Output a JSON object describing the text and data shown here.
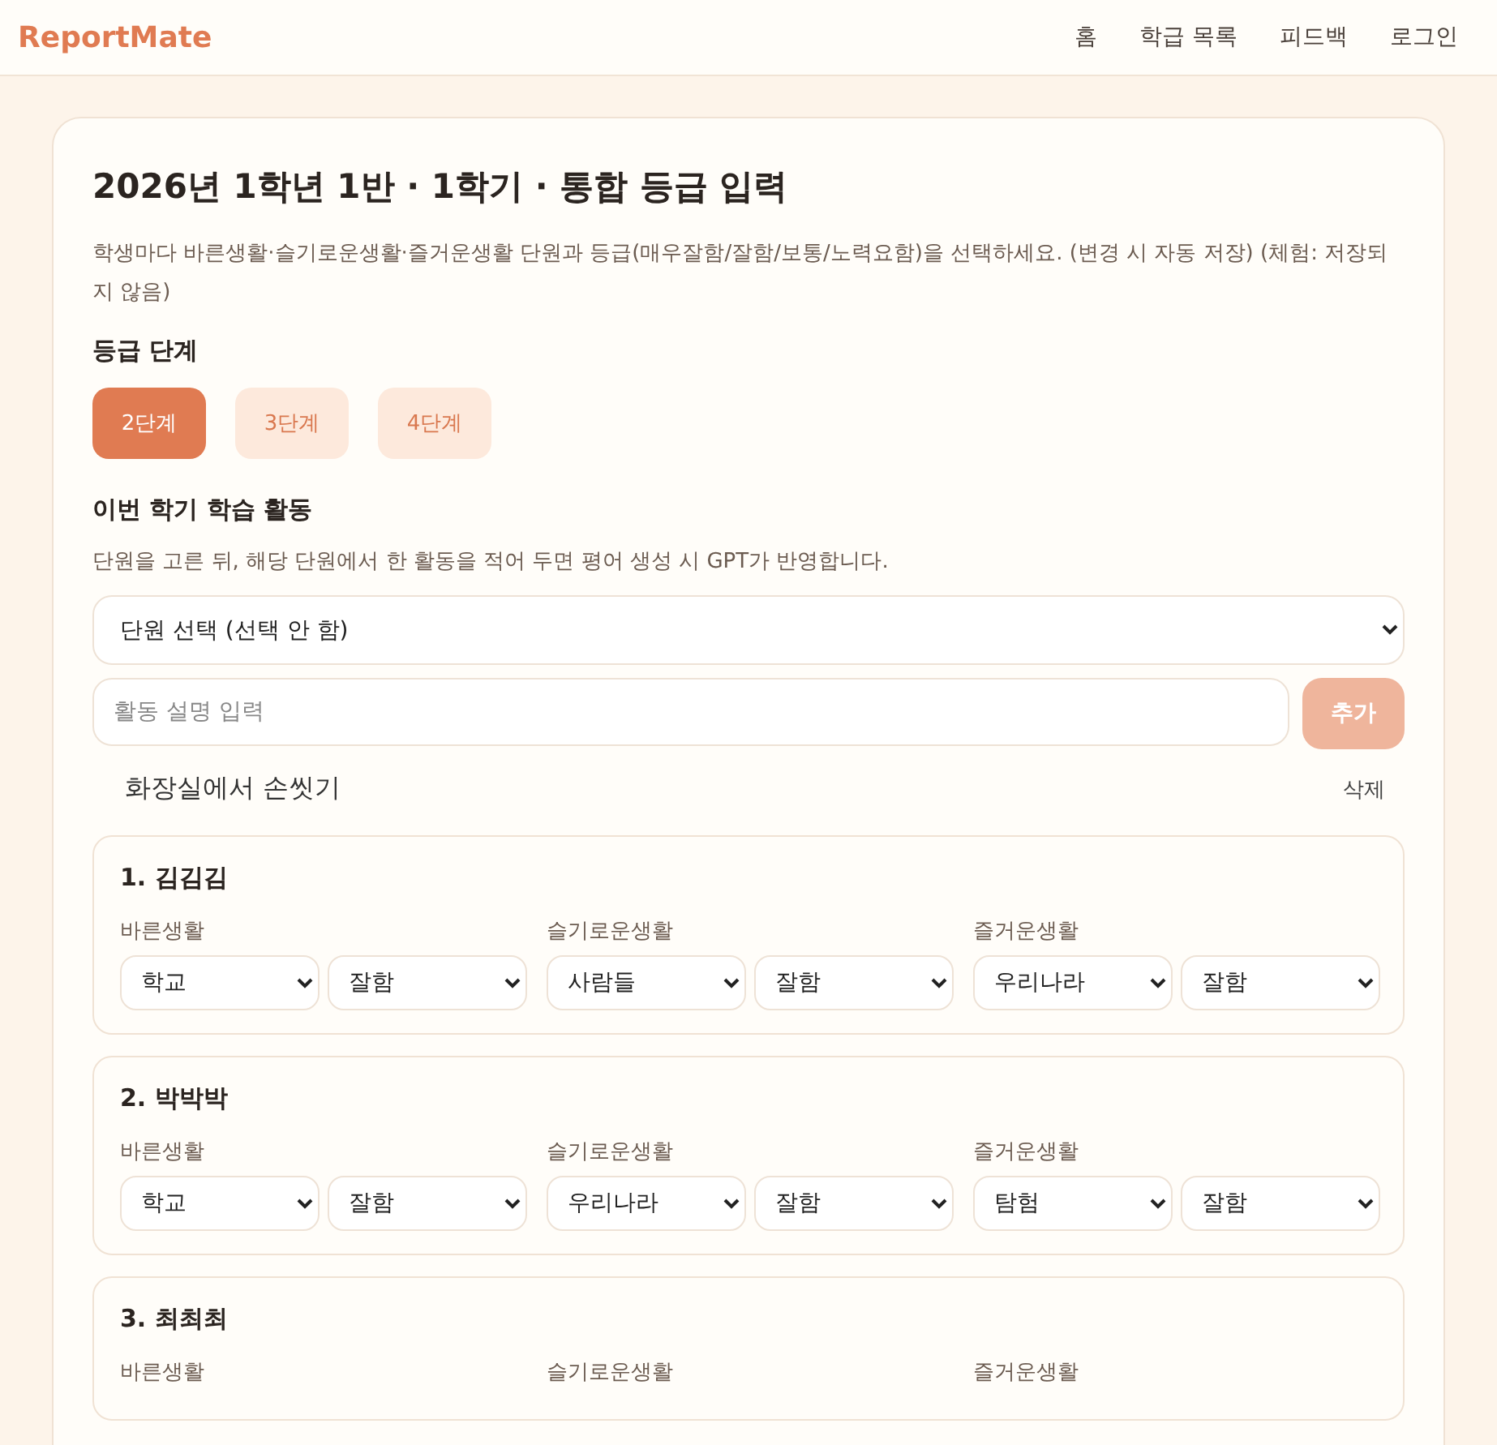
{
  "header": {
    "logo": "ReportMate",
    "nav": [
      "홈",
      "학급 목록",
      "피드백",
      "로그인"
    ]
  },
  "page": {
    "title": "2026년 1학년 1반 · 1학기 · 통합 등급 입력",
    "description": "학생마다 바른생활·슬기로운생활·즐거운생활 단원과 등급(매우잘함/잘함/보통/노력요함)을 선택하세요. (변경 시 자동 저장) (체험: 저장되지 않음)"
  },
  "grade_levels": {
    "heading": "등급 단계",
    "options": [
      {
        "label": "2단계",
        "selected": true
      },
      {
        "label": "3단계",
        "selected": false
      },
      {
        "label": "4단계",
        "selected": false
      }
    ]
  },
  "activities": {
    "heading": "이번 학기 학습 활동",
    "hint": "단원을 고른 뒤, 해당 단원에서 한 활동을 적어 두면 평어 생성 시 GPT가 반영합니다.",
    "unit_select": {
      "value": "단원 선택 (선택 안 함)"
    },
    "input": {
      "placeholder": "활동 설명 입력"
    },
    "add_button": {
      "label": "추가",
      "disabled": true
    },
    "items": [
      {
        "text": "화장실에서 손씻기",
        "delete_label": "삭제"
      }
    ]
  },
  "students": [
    {
      "name": "1. 김김김",
      "areas": [
        {
          "label": "바른생활",
          "unit": "학교",
          "grade": "잘함"
        },
        {
          "label": "슬기로운생활",
          "unit": "사람들",
          "grade": "잘함"
        },
        {
          "label": "즐거운생활",
          "unit": "우리나라",
          "grade": "잘함"
        }
      ]
    },
    {
      "name": "2. 박박박",
      "areas": [
        {
          "label": "바른생활",
          "unit": "학교",
          "grade": "잘함"
        },
        {
          "label": "슬기로운생활",
          "unit": "우리나라",
          "grade": "잘함"
        },
        {
          "label": "즐거운생활",
          "unit": "탐험",
          "grade": "잘함"
        }
      ]
    },
    {
      "name": "3. 최최최",
      "areas": [
        {
          "label": "바른생활"
        },
        {
          "label": "슬기로운생활"
        },
        {
          "label": "즐거운생활"
        }
      ]
    }
  ]
}
